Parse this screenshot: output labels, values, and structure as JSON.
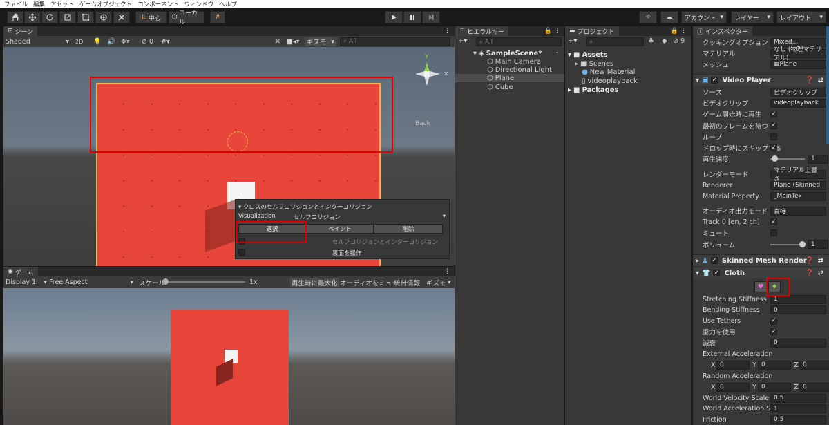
{
  "menu": [
    "ファイル",
    "編集",
    "アセット",
    "ゲームオブジェクト",
    "コンポーネント",
    "ウィンドウ",
    "ヘルプ"
  ],
  "toolbar": {
    "center": "中心",
    "local": "ローカル",
    "account": "アカウント",
    "layers": "レイヤー",
    "layout": "レイアウト"
  },
  "scene": {
    "tab": "シーン",
    "shading": "Shaded",
    "mode2d": "2D",
    "gizmo_count": "0",
    "gizmos": "ギズモ",
    "search_placeholder": "All",
    "back": "Back",
    "axis_y": "y",
    "axis_x": "x"
  },
  "cloth_popup": {
    "title": "クロスのセルフコリジョンとインターコリジョン",
    "visualization_label": "Visualization",
    "visualization_value": "セルフコリジョン",
    "select": "選択",
    "paint": "ペイント",
    "delete": "削除",
    "self_inter": "セルフコリジョンとインターコリジョン",
    "backface": "裏面を操作"
  },
  "game": {
    "tab": "ゲーム",
    "display": "Display 1",
    "aspect": "Free Aspect",
    "scale_label": "スケール",
    "scale_value": "1x",
    "maximize": "再生時に最大化",
    "mute": "オーディオをミュート",
    "stats": "統計情報",
    "gizmos": "ギズモ"
  },
  "hierarchy": {
    "tab": "ヒエラルキー",
    "search_placeholder": "All",
    "scene": "SampleScene*",
    "items": [
      "Main Camera",
      "Directional Light",
      "Plane",
      "Cube"
    ],
    "selected": "Plane"
  },
  "project": {
    "tab": "プロジェクト",
    "count": "9",
    "assets": "Assets",
    "items": [
      "Scenes",
      "New Material",
      "videoplayback"
    ],
    "packages": "Packages"
  },
  "inspector": {
    "tab": "インスペクター",
    "top_rows": [
      {
        "label": "クッキングオプション",
        "value": "Mixed..."
      },
      {
        "label": "マテリアル",
        "value": "なし (物理マテリアル)"
      },
      {
        "label": "メッシュ",
        "value": "Plane"
      }
    ],
    "video_player": {
      "title": "Video Player",
      "rows": [
        {
          "label": "ソース",
          "value": "ビデオクリップ"
        },
        {
          "label": "ビデオクリップ",
          "value": "videoplayback"
        },
        {
          "label": "ゲーム開始時に再生",
          "check": "✓"
        },
        {
          "label": "最初のフレームを待つ",
          "check": "✓"
        },
        {
          "label": "ループ",
          "check": ""
        },
        {
          "label": "ドロップ時にスキップする",
          "check": "✓"
        },
        {
          "label": "再生速度",
          "value": "1"
        }
      ],
      "rows2": [
        {
          "label": "レンダーモード",
          "value": "マテリアル上書き"
        },
        {
          "label": "Renderer",
          "value": "Plane (Skinned"
        },
        {
          "label": "Material Property",
          "value": "_MainTex"
        }
      ],
      "rows3": [
        {
          "label": "オーディオ出力モード",
          "value": "直接"
        },
        {
          "label": "Track 0 [en, 2 ch]",
          "check": "✓"
        },
        {
          "label": "ミュート",
          "check": ""
        },
        {
          "label": "ボリューム",
          "value": "1"
        }
      ]
    },
    "skinned": {
      "title": "Skinned Mesh Render"
    },
    "cloth": {
      "title": "Cloth",
      "rows": [
        {
          "label": "Stretching Stiffness",
          "value": "1"
        },
        {
          "label": "Bending Stiffness",
          "value": "0"
        },
        {
          "label": "Use Tethers",
          "check": "✓"
        },
        {
          "label": "重力を使用",
          "check": "✓"
        },
        {
          "label": "減衰",
          "value": "0"
        }
      ],
      "ext_accel": "External Acceleration",
      "rand_accel": "Random Acceleration",
      "x": "X",
      "y": "Y",
      "z": "Z",
      "ext_values": [
        "0",
        "0",
        "0"
      ],
      "rand_values": [
        "0",
        "0",
        "0"
      ],
      "rows2": [
        {
          "label": "World Velocity Scale",
          "value": "0.5"
        },
        {
          "label": "World Acceleration S",
          "value": "1"
        },
        {
          "label": "Friction",
          "value": "0.5"
        }
      ]
    }
  },
  "colors": {
    "red": "#e8463b",
    "accent": "#2c5d87"
  }
}
